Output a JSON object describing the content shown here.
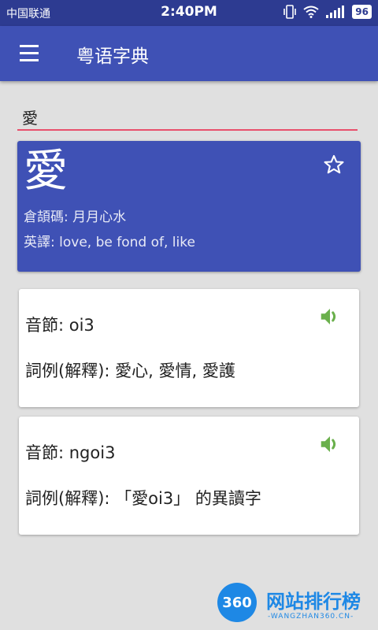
{
  "status_bar": {
    "carrier": "中国联通",
    "time": "2:40PM",
    "battery": "96"
  },
  "app_bar": {
    "title": "粤语字典"
  },
  "search": {
    "value": "愛"
  },
  "main_card": {
    "character": "愛",
    "cangjie_label": "倉頡碼: 月月心水",
    "english_label": "英譯: love, be fond of, like"
  },
  "syllables": [
    {
      "syllable_label": "音節: oi3",
      "example_label": "詞例(解釋): 愛心, 愛情, 愛護"
    },
    {
      "syllable_label": "音節: ngoi3",
      "example_label": "詞例(解釋): 「愛oi3」 的異讀字"
    }
  ],
  "watermark": {
    "logo_number": "360",
    "text": "网站排行榜",
    "sub": "-WANGZHAN360.CN-"
  },
  "colors": {
    "primary": "#3f51b5",
    "status_bar": "#2d3b91",
    "accent_underline": "#e8506c",
    "speaker": "#6ab04c"
  }
}
